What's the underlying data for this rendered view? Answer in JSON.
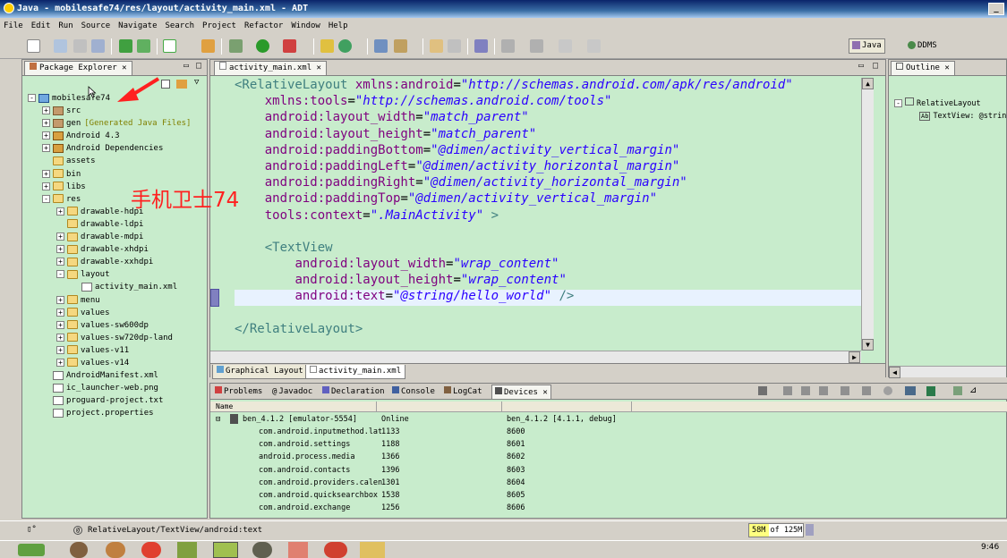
{
  "window": {
    "title": "Java - mobilesafe74/res/layout/activity_main.xml - ADT"
  },
  "menu": [
    "File",
    "Edit",
    "Run",
    "Source",
    "Navigate",
    "Search",
    "Project",
    "Refactor",
    "Window",
    "Help"
  ],
  "perspectives": {
    "java": "Java",
    "ddms": "DDMS"
  },
  "package_explorer": {
    "title": "Package Explorer",
    "tree": [
      {
        "label": "mobilesafe74",
        "level": 0,
        "exp": "-",
        "icon": "proj"
      },
      {
        "label": "src",
        "level": 1,
        "exp": "+",
        "icon": "pkg"
      },
      {
        "label": "gen",
        "level": 1,
        "exp": "+",
        "icon": "pkg",
        "extra": "[Generated Java Files]"
      },
      {
        "label": "Android 4.3",
        "level": 1,
        "exp": "+",
        "icon": "lib"
      },
      {
        "label": "Android Dependencies",
        "level": 1,
        "exp": "+",
        "icon": "lib"
      },
      {
        "label": "assets",
        "level": 1,
        "exp": "",
        "icon": "folder"
      },
      {
        "label": "bin",
        "level": 1,
        "exp": "+",
        "icon": "folder"
      },
      {
        "label": "libs",
        "level": 1,
        "exp": "+",
        "icon": "folder"
      },
      {
        "label": "res",
        "level": 1,
        "exp": "-",
        "icon": "folder"
      },
      {
        "label": "drawable-hdpi",
        "level": 2,
        "exp": "+",
        "icon": "folder"
      },
      {
        "label": "drawable-ldpi",
        "level": 2,
        "exp": "",
        "icon": "folder"
      },
      {
        "label": "drawable-mdpi",
        "level": 2,
        "exp": "+",
        "icon": "folder"
      },
      {
        "label": "drawable-xhdpi",
        "level": 2,
        "exp": "+",
        "icon": "folder"
      },
      {
        "label": "drawable-xxhdpi",
        "level": 2,
        "exp": "+",
        "icon": "folder"
      },
      {
        "label": "layout",
        "level": 2,
        "exp": "-",
        "icon": "folder"
      },
      {
        "label": "activity_main.xml",
        "level": 3,
        "exp": "",
        "icon": "file"
      },
      {
        "label": "menu",
        "level": 2,
        "exp": "+",
        "icon": "folder"
      },
      {
        "label": "values",
        "level": 2,
        "exp": "+",
        "icon": "folder"
      },
      {
        "label": "values-sw600dp",
        "level": 2,
        "exp": "+",
        "icon": "folder"
      },
      {
        "label": "values-sw720dp-land",
        "level": 2,
        "exp": "+",
        "icon": "folder"
      },
      {
        "label": "values-v11",
        "level": 2,
        "exp": "+",
        "icon": "folder"
      },
      {
        "label": "values-v14",
        "level": 2,
        "exp": "+",
        "icon": "folder"
      },
      {
        "label": "AndroidManifest.xml",
        "level": 1,
        "exp": "",
        "icon": "file"
      },
      {
        "label": "ic_launcher-web.png",
        "level": 1,
        "exp": "",
        "icon": "file"
      },
      {
        "label": "proguard-project.txt",
        "level": 1,
        "exp": "",
        "icon": "file"
      },
      {
        "label": "project.properties",
        "level": 1,
        "exp": "",
        "icon": "file"
      }
    ]
  },
  "annotation": "手机卫士74",
  "editor": {
    "tab": "activity_main.xml",
    "bottom_tabs": [
      "Graphical Layout",
      "activity_main.xml"
    ],
    "lines": [
      [
        [
          "tag",
          "<RelativeLayout "
        ],
        [
          "attr",
          "xmlns:android"
        ],
        [
          "eq",
          "="
        ],
        [
          "val",
          "\"http://schemas.android.com/apk/res/android\""
        ]
      ],
      [
        [
          "t",
          "    "
        ],
        [
          "attr",
          "xmlns:tools"
        ],
        [
          "eq",
          "="
        ],
        [
          "val",
          "\"http://schemas.android.com/tools\""
        ]
      ],
      [
        [
          "t",
          "    "
        ],
        [
          "attr",
          "android:layout_width"
        ],
        [
          "eq",
          "="
        ],
        [
          "val",
          "\"match_parent\""
        ]
      ],
      [
        [
          "t",
          "    "
        ],
        [
          "attr",
          "android:layout_height"
        ],
        [
          "eq",
          "="
        ],
        [
          "val",
          "\"match_parent\""
        ]
      ],
      [
        [
          "t",
          "    "
        ],
        [
          "attr",
          "android:paddingBottom"
        ],
        [
          "eq",
          "="
        ],
        [
          "val",
          "\"@dimen/activity_vertical_margin\""
        ]
      ],
      [
        [
          "t",
          "    "
        ],
        [
          "attr",
          "android:paddingLeft"
        ],
        [
          "eq",
          "="
        ],
        [
          "val",
          "\"@dimen/activity_horizontal_margin\""
        ]
      ],
      [
        [
          "t",
          "    "
        ],
        [
          "attr",
          "android:paddingRight"
        ],
        [
          "eq",
          "="
        ],
        [
          "val",
          "\"@dimen/activity_horizontal_margin\""
        ]
      ],
      [
        [
          "t",
          "    "
        ],
        [
          "attr",
          "android:paddingTop"
        ],
        [
          "eq",
          "="
        ],
        [
          "val",
          "\"@dimen/activity_vertical_margin\""
        ]
      ],
      [
        [
          "t",
          "    "
        ],
        [
          "attr",
          "tools:context"
        ],
        [
          "eq",
          "="
        ],
        [
          "val",
          "\".MainActivity\""
        ],
        [
          "tag",
          " >"
        ]
      ],
      [
        [
          "t",
          ""
        ]
      ],
      [
        [
          "t",
          "    "
        ],
        [
          "tag",
          "<TextView"
        ]
      ],
      [
        [
          "t",
          "        "
        ],
        [
          "attr",
          "android:layout_width"
        ],
        [
          "eq",
          "="
        ],
        [
          "val",
          "\"wrap_content\""
        ]
      ],
      [
        [
          "t",
          "        "
        ],
        [
          "attr",
          "android:layout_height"
        ],
        [
          "eq",
          "="
        ],
        [
          "val",
          "\"wrap_content\""
        ]
      ],
      [
        [
          "t",
          "        "
        ],
        [
          "attr",
          "android:text"
        ],
        [
          "eq",
          "="
        ],
        [
          "val",
          "\"@string/hello_world\""
        ],
        [
          "tag",
          " />"
        ]
      ],
      [
        [
          "t",
          ""
        ]
      ],
      [
        [
          "tag",
          "</RelativeLayout>"
        ]
      ]
    ]
  },
  "outline": {
    "title": "Outline",
    "items": [
      {
        "label": "RelativeLayout",
        "level": 0
      },
      {
        "label": "TextView: @strin",
        "level": 1
      }
    ]
  },
  "bottom_panel": {
    "tabs": [
      "Problems",
      "Javadoc",
      "Declaration",
      "Console",
      "LogCat",
      "Devices"
    ],
    "header": "Name",
    "device": {
      "name": "ben_4.1.2 [emulator-5554]",
      "status": "Online",
      "info": "ben_4.1.2 [4.1.1, debug]"
    },
    "processes": [
      {
        "name": "com.android.inputmethod.lat",
        "pid": "1133",
        "port": "8600"
      },
      {
        "name": "com.android.settings",
        "pid": "1188",
        "port": "8601"
      },
      {
        "name": "android.process.media",
        "pid": "1366",
        "port": "8602"
      },
      {
        "name": "com.android.contacts",
        "pid": "1396",
        "port": "8603"
      },
      {
        "name": "com.android.providers.calen",
        "pid": "1301",
        "port": "8604"
      },
      {
        "name": "com.android.quicksearchbox",
        "pid": "1538",
        "port": "8605"
      },
      {
        "name": "com.android.exchange",
        "pid": "1256",
        "port": "8606"
      }
    ]
  },
  "status": {
    "path": "RelativeLayout/TextView/android:text",
    "memory": "58M of 125M"
  },
  "clock": "9:46"
}
